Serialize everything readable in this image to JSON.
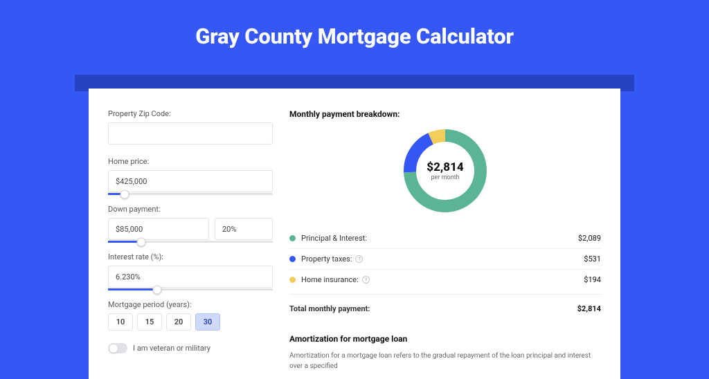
{
  "title": "Gray County Mortgage Calculator",
  "inputs": {
    "zip": {
      "label": "Property Zip Code:",
      "value": ""
    },
    "home_price": {
      "label": "Home price:",
      "value": "$425,000",
      "slider_pct": 10
    },
    "down_payment": {
      "label": "Down payment:",
      "value": "$85,000",
      "pct": "20%",
      "slider_pct": 20
    },
    "rate": {
      "label": "Interest rate (%):",
      "value": "6.230%",
      "slider_pct": 30
    },
    "period": {
      "label": "Mortgage period (years):",
      "options": [
        "10",
        "15",
        "20",
        "30"
      ],
      "selected": "30"
    },
    "veteran": {
      "label": "I am veteran or military",
      "on": false
    }
  },
  "breakdown": {
    "title": "Monthly payment breakdown:",
    "center_value": "$2,814",
    "center_sub": "per month",
    "items": [
      {
        "label": "Principal & Interest:",
        "value": "$2,089",
        "color": "#5bb595",
        "info": false
      },
      {
        "label": "Property taxes:",
        "value": "$531",
        "color": "#3557f5",
        "info": true
      },
      {
        "label": "Home insurance:",
        "value": "$194",
        "color": "#f3cd59",
        "info": true
      }
    ],
    "total_label": "Total monthly payment:",
    "total_value": "$2,814"
  },
  "amortization": {
    "title": "Amortization for mortgage loan",
    "text": "Amortization for a mortgage loan refers to the gradual repayment of the loan principal and interest over a specified"
  },
  "chart_data": {
    "type": "pie",
    "title": "Monthly payment breakdown",
    "categories": [
      "Principal & Interest",
      "Property taxes",
      "Home insurance"
    ],
    "values": [
      2089,
      531,
      194
    ],
    "colors": [
      "#5bb595",
      "#3557f5",
      "#f3cd59"
    ],
    "total": 2814,
    "unit": "USD per month"
  }
}
